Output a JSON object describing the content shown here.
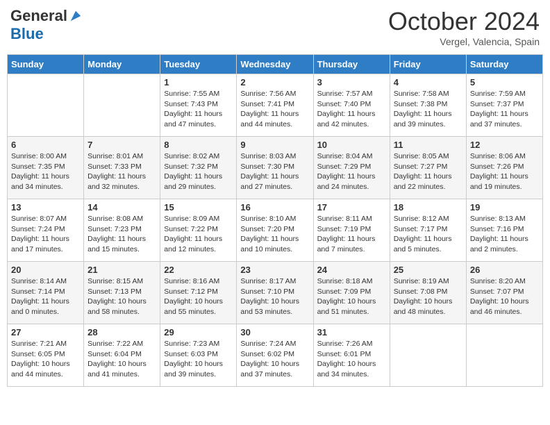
{
  "header": {
    "logo": {
      "general": "General",
      "blue": "Blue"
    },
    "title": "October 2024",
    "subtitle": "Vergel, Valencia, Spain"
  },
  "calendar": {
    "days_of_week": [
      "Sunday",
      "Monday",
      "Tuesday",
      "Wednesday",
      "Thursday",
      "Friday",
      "Saturday"
    ],
    "weeks": [
      [
        {
          "day": "",
          "sunrise": "",
          "sunset": "",
          "daylight": ""
        },
        {
          "day": "",
          "sunrise": "",
          "sunset": "",
          "daylight": ""
        },
        {
          "day": "1",
          "sunrise": "Sunrise: 7:55 AM",
          "sunset": "Sunset: 7:43 PM",
          "daylight": "Daylight: 11 hours and 47 minutes."
        },
        {
          "day": "2",
          "sunrise": "Sunrise: 7:56 AM",
          "sunset": "Sunset: 7:41 PM",
          "daylight": "Daylight: 11 hours and 44 minutes."
        },
        {
          "day": "3",
          "sunrise": "Sunrise: 7:57 AM",
          "sunset": "Sunset: 7:40 PM",
          "daylight": "Daylight: 11 hours and 42 minutes."
        },
        {
          "day": "4",
          "sunrise": "Sunrise: 7:58 AM",
          "sunset": "Sunset: 7:38 PM",
          "daylight": "Daylight: 11 hours and 39 minutes."
        },
        {
          "day": "5",
          "sunrise": "Sunrise: 7:59 AM",
          "sunset": "Sunset: 7:37 PM",
          "daylight": "Daylight: 11 hours and 37 minutes."
        }
      ],
      [
        {
          "day": "6",
          "sunrise": "Sunrise: 8:00 AM",
          "sunset": "Sunset: 7:35 PM",
          "daylight": "Daylight: 11 hours and 34 minutes."
        },
        {
          "day": "7",
          "sunrise": "Sunrise: 8:01 AM",
          "sunset": "Sunset: 7:33 PM",
          "daylight": "Daylight: 11 hours and 32 minutes."
        },
        {
          "day": "8",
          "sunrise": "Sunrise: 8:02 AM",
          "sunset": "Sunset: 7:32 PM",
          "daylight": "Daylight: 11 hours and 29 minutes."
        },
        {
          "day": "9",
          "sunrise": "Sunrise: 8:03 AM",
          "sunset": "Sunset: 7:30 PM",
          "daylight": "Daylight: 11 hours and 27 minutes."
        },
        {
          "day": "10",
          "sunrise": "Sunrise: 8:04 AM",
          "sunset": "Sunset: 7:29 PM",
          "daylight": "Daylight: 11 hours and 24 minutes."
        },
        {
          "day": "11",
          "sunrise": "Sunrise: 8:05 AM",
          "sunset": "Sunset: 7:27 PM",
          "daylight": "Daylight: 11 hours and 22 minutes."
        },
        {
          "day": "12",
          "sunrise": "Sunrise: 8:06 AM",
          "sunset": "Sunset: 7:26 PM",
          "daylight": "Daylight: 11 hours and 19 minutes."
        }
      ],
      [
        {
          "day": "13",
          "sunrise": "Sunrise: 8:07 AM",
          "sunset": "Sunset: 7:24 PM",
          "daylight": "Daylight: 11 hours and 17 minutes."
        },
        {
          "day": "14",
          "sunrise": "Sunrise: 8:08 AM",
          "sunset": "Sunset: 7:23 PM",
          "daylight": "Daylight: 11 hours and 15 minutes."
        },
        {
          "day": "15",
          "sunrise": "Sunrise: 8:09 AM",
          "sunset": "Sunset: 7:22 PM",
          "daylight": "Daylight: 11 hours and 12 minutes."
        },
        {
          "day": "16",
          "sunrise": "Sunrise: 8:10 AM",
          "sunset": "Sunset: 7:20 PM",
          "daylight": "Daylight: 11 hours and 10 minutes."
        },
        {
          "day": "17",
          "sunrise": "Sunrise: 8:11 AM",
          "sunset": "Sunset: 7:19 PM",
          "daylight": "Daylight: 11 hours and 7 minutes."
        },
        {
          "day": "18",
          "sunrise": "Sunrise: 8:12 AM",
          "sunset": "Sunset: 7:17 PM",
          "daylight": "Daylight: 11 hours and 5 minutes."
        },
        {
          "day": "19",
          "sunrise": "Sunrise: 8:13 AM",
          "sunset": "Sunset: 7:16 PM",
          "daylight": "Daylight: 11 hours and 2 minutes."
        }
      ],
      [
        {
          "day": "20",
          "sunrise": "Sunrise: 8:14 AM",
          "sunset": "Sunset: 7:14 PM",
          "daylight": "Daylight: 11 hours and 0 minutes."
        },
        {
          "day": "21",
          "sunrise": "Sunrise: 8:15 AM",
          "sunset": "Sunset: 7:13 PM",
          "daylight": "Daylight: 10 hours and 58 minutes."
        },
        {
          "day": "22",
          "sunrise": "Sunrise: 8:16 AM",
          "sunset": "Sunset: 7:12 PM",
          "daylight": "Daylight: 10 hours and 55 minutes."
        },
        {
          "day": "23",
          "sunrise": "Sunrise: 8:17 AM",
          "sunset": "Sunset: 7:10 PM",
          "daylight": "Daylight: 10 hours and 53 minutes."
        },
        {
          "day": "24",
          "sunrise": "Sunrise: 8:18 AM",
          "sunset": "Sunset: 7:09 PM",
          "daylight": "Daylight: 10 hours and 51 minutes."
        },
        {
          "day": "25",
          "sunrise": "Sunrise: 8:19 AM",
          "sunset": "Sunset: 7:08 PM",
          "daylight": "Daylight: 10 hours and 48 minutes."
        },
        {
          "day": "26",
          "sunrise": "Sunrise: 8:20 AM",
          "sunset": "Sunset: 7:07 PM",
          "daylight": "Daylight: 10 hours and 46 minutes."
        }
      ],
      [
        {
          "day": "27",
          "sunrise": "Sunrise: 7:21 AM",
          "sunset": "Sunset: 6:05 PM",
          "daylight": "Daylight: 10 hours and 44 minutes."
        },
        {
          "day": "28",
          "sunrise": "Sunrise: 7:22 AM",
          "sunset": "Sunset: 6:04 PM",
          "daylight": "Daylight: 10 hours and 41 minutes."
        },
        {
          "day": "29",
          "sunrise": "Sunrise: 7:23 AM",
          "sunset": "Sunset: 6:03 PM",
          "daylight": "Daylight: 10 hours and 39 minutes."
        },
        {
          "day": "30",
          "sunrise": "Sunrise: 7:24 AM",
          "sunset": "Sunset: 6:02 PM",
          "daylight": "Daylight: 10 hours and 37 minutes."
        },
        {
          "day": "31",
          "sunrise": "Sunrise: 7:26 AM",
          "sunset": "Sunset: 6:01 PM",
          "daylight": "Daylight: 10 hours and 34 minutes."
        },
        {
          "day": "",
          "sunrise": "",
          "sunset": "",
          "daylight": ""
        },
        {
          "day": "",
          "sunrise": "",
          "sunset": "",
          "daylight": ""
        }
      ]
    ]
  }
}
